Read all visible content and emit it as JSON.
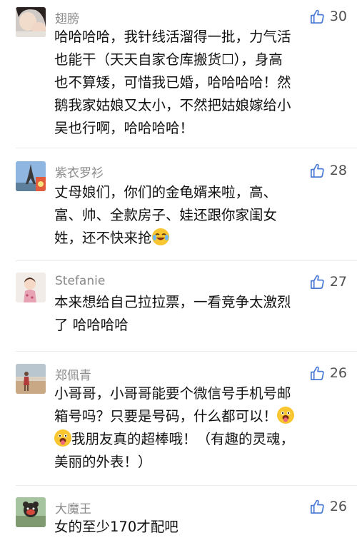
{
  "comments": [
    {
      "name": "翅膀",
      "likes": "30",
      "lines": [
        "哈哈哈哈，我针线活溜得一批，力气活",
        "也能干（天天自家仓库搬货☐），身高",
        "也不算矮，可惜我已婚，哈哈哈哈！然",
        "鹅我家姑娘又太小，不然把姑娘嫁给小",
        "吴也行啊，哈哈哈哈！"
      ]
    },
    {
      "name": "紫衣罗衫",
      "likes": "28",
      "lines": [
        "丈母娘们，你们的金龟婿来啦，高、",
        "富、帅、全款房子、娃还跟你家闺女",
        "姓，还不快来抢"
      ]
    },
    {
      "name": "Stefanie",
      "likes": "27",
      "lines": [
        "本来想给自己拉拉票，一看竞争太激烈",
        "了 哈哈哈哈"
      ]
    },
    {
      "name": "郑佩青",
      "likes": "26",
      "lines": [
        "小哥哥，小哥哥能要个微信号手机号邮",
        "箱号吗？只要是号码，什么都可以！",
        "我朋友真的超棒哦！（有趣的灵魂，",
        "美丽的外表！）"
      ]
    },
    {
      "name": "大魔王",
      "likes": "26",
      "lines": [
        "女的至少170才配吧"
      ]
    }
  ],
  "icons": {
    "like": "thumbs-up-outline-icon",
    "emoji_laugh_cry": "laughing-crying-emoji-icon",
    "emoji_tongue": "tongue-out-emoji-icon"
  },
  "colors": {
    "name": "#8a8a8a",
    "text": "#111111",
    "like_icon": "#4b7bd6",
    "like_count": "#505050"
  }
}
